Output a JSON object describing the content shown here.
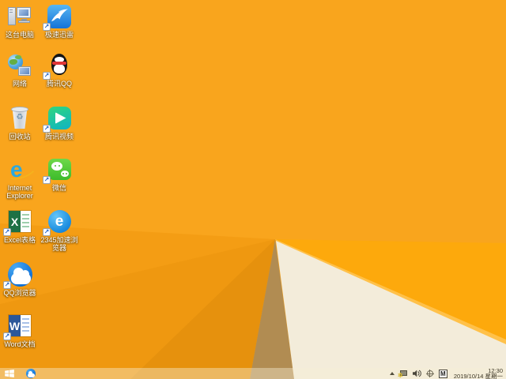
{
  "wallpaper": {
    "base_color": "#F9A51D",
    "facet_colors": [
      "#F49D14",
      "#EF9810",
      "#E6910D",
      "#B18C52",
      "#FDA90C",
      "#FFC14A",
      "#F3ECDA"
    ],
    "taskbar_tint": "rgba(246,238,214,0.42)"
  },
  "desktop": {
    "icons": [
      {
        "id": "this-pc",
        "label": "这台电脑"
      },
      {
        "id": "xunlei",
        "label": "极速迅雷"
      },
      {
        "id": "network",
        "label": "网络"
      },
      {
        "id": "tencent-qq",
        "label": "腾讯QQ"
      },
      {
        "id": "recycle-bin",
        "label": "回收站"
      },
      {
        "id": "tencent-video",
        "label": "腾讯视频"
      },
      {
        "id": "internet-explorer",
        "label": "Internet Explorer"
      },
      {
        "id": "wechat",
        "label": "微信"
      },
      {
        "id": "excel",
        "label": "Excel表格"
      },
      {
        "id": "2345-browser",
        "label": "2345加速浏览器"
      },
      {
        "id": "qq-browser",
        "label": "QQ浏览器"
      },
      {
        "id": "word",
        "label": "Word文档"
      }
    ],
    "shortcut_arrow_glyph": "↗",
    "recycle_symbol": "♻",
    "ie_letter": "e",
    "excel_letter": "X",
    "word_letter": "W",
    "browser2345_letter": "e"
  },
  "taskbar": {
    "tray": {
      "ime_label": "M",
      "icon_names": [
        "hidden-icons-chevron",
        "network-status",
        "volume",
        "crosshair-utility",
        "ime-indicator"
      ],
      "network_warning_glyph": "✲"
    },
    "clock": {
      "time": "12:30",
      "date": "2019/10/14 星期一"
    }
  }
}
